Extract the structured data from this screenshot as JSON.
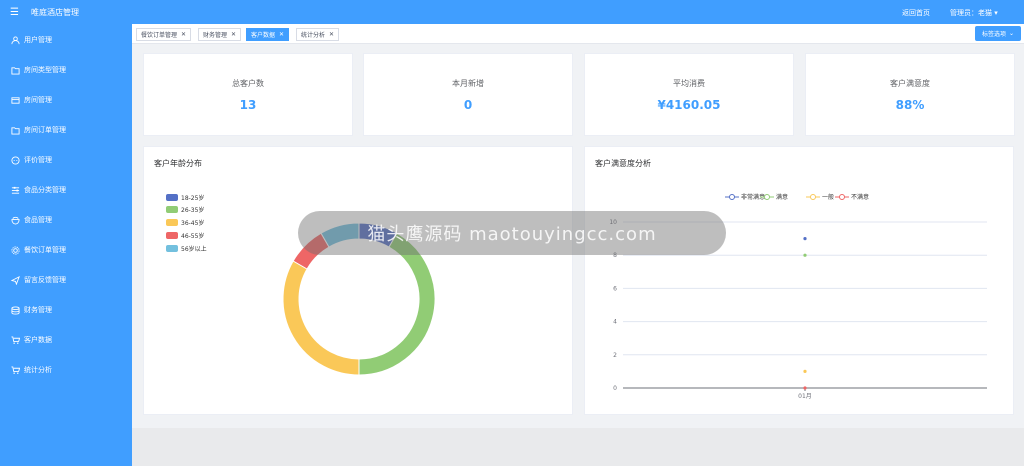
{
  "app": {
    "title": "唯庭酒店管理"
  },
  "header": {
    "home_link": "返回首页",
    "admin_label": "管理员：老猫"
  },
  "sidebar": {
    "items": [
      {
        "label": "用户管理",
        "icon": "user-icon"
      },
      {
        "label": "房间类型管理",
        "icon": "folder-icon"
      },
      {
        "label": "房间管理",
        "icon": "room-icon"
      },
      {
        "label": "房间订单管理",
        "icon": "folder-icon"
      },
      {
        "label": "评价管理",
        "icon": "chat-icon"
      },
      {
        "label": "食品分类管理",
        "icon": "sliders-icon"
      },
      {
        "label": "食品管理",
        "icon": "bowl-icon"
      },
      {
        "label": "餐饮订单管理",
        "icon": "gear-icon"
      },
      {
        "label": "留言反馈管理",
        "icon": "send-icon"
      },
      {
        "label": "财务管理",
        "icon": "database-icon"
      },
      {
        "label": "客户数据",
        "icon": "cart-icon"
      },
      {
        "label": "统计分析",
        "icon": "cart-icon"
      }
    ]
  },
  "tabs": [
    {
      "label": "餐饮订单管理",
      "active": false
    },
    {
      "label": "财务管理",
      "active": false
    },
    {
      "label": "客户数据",
      "active": true
    },
    {
      "label": "统计分析",
      "active": false
    }
  ],
  "tag_select": "标签选项",
  "stats": [
    {
      "label": "总客户数",
      "value": "13"
    },
    {
      "label": "本月新增",
      "value": "0"
    },
    {
      "label": "平均消费",
      "value": "¥4160.05"
    },
    {
      "label": "客户满意度",
      "value": "88%"
    }
  ],
  "watermark": "猫头鹰源码 maotouyingcc.com",
  "chart_data": [
    {
      "type": "pie",
      "title": "客户年龄分布",
      "categories": [
        "18-25岁",
        "26-35岁",
        "36-45岁",
        "46-55岁",
        "56岁以上"
      ],
      "values": [
        1,
        5,
        4,
        1,
        1
      ],
      "colors": [
        "#5470c6",
        "#91cc75",
        "#fac858",
        "#ee6666",
        "#73c0de"
      ]
    },
    {
      "type": "line",
      "title": "客户满意度分析",
      "x": [
        "01月"
      ],
      "ylim": [
        0,
        10
      ],
      "yticks": [
        "0",
        "2",
        "4",
        "6",
        "8",
        "10"
      ],
      "series": [
        {
          "name": "非常满意",
          "values": [
            9
          ],
          "color": "#5470c6"
        },
        {
          "name": "满意",
          "values": [
            8
          ],
          "color": "#91cc75"
        },
        {
          "name": "一般",
          "values": [
            1
          ],
          "color": "#fac858"
        },
        {
          "name": "不满意",
          "values": [
            0
          ],
          "color": "#ee6666"
        }
      ]
    }
  ]
}
